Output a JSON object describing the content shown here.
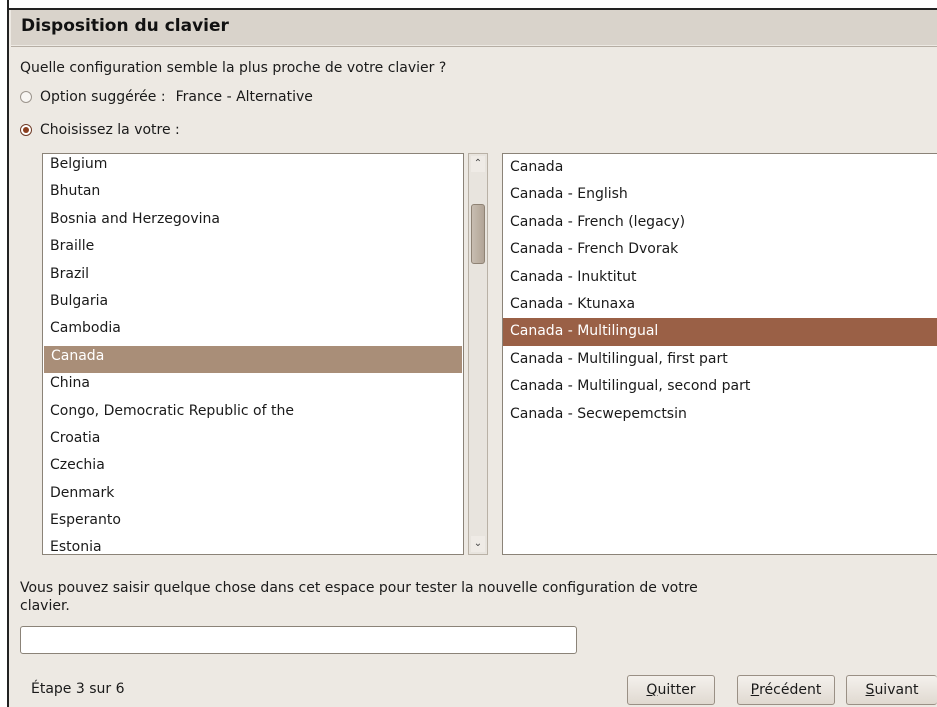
{
  "header": {
    "title": "Disposition du clavier"
  },
  "question": "Quelle configuration semble la plus proche de votre clavier ?",
  "suggested": {
    "label": "Option suggérée :",
    "value": "France - Alternative",
    "checked": false
  },
  "choose": {
    "label": "Choisissez la votre :",
    "checked": true
  },
  "countries": [
    "Belgium",
    "Bhutan",
    "Bosnia and Herzegovina",
    "Braille",
    "Brazil",
    "Bulgaria",
    "Cambodia",
    "Canada",
    "China",
    "Congo, Democratic Republic of the",
    "Croatia",
    "Czechia",
    "Denmark",
    "Esperanto",
    "Estonia"
  ],
  "selected_country": "Canada",
  "variants": [
    "Canada",
    "Canada - English",
    "Canada - French (legacy)",
    "Canada - French Dvorak",
    "Canada - Inuktitut",
    "Canada - Ktunaxa",
    "Canada - Multilingual",
    "Canada - Multilingual, first part",
    "Canada - Multilingual, second part",
    "Canada - Secwepemctsin"
  ],
  "selected_variant": "Canada - Multilingual",
  "hint": "Vous pouvez saisir quelque chose dans cet espace pour tester la nouvelle configuration de votre clavier.",
  "test_input": {
    "value": ""
  },
  "footer": {
    "step": "Étape 3 sur 6",
    "quit": {
      "mnemonic": "Q",
      "rest": "uitter"
    },
    "prev": {
      "mnemonic": "P",
      "rest": "récédent"
    },
    "next": {
      "mnemonic": "S",
      "rest": "uivant"
    }
  },
  "colors": {
    "selection_country": "#a98e78",
    "selection_variant": "#9a6046",
    "background": "#ede9e3"
  }
}
